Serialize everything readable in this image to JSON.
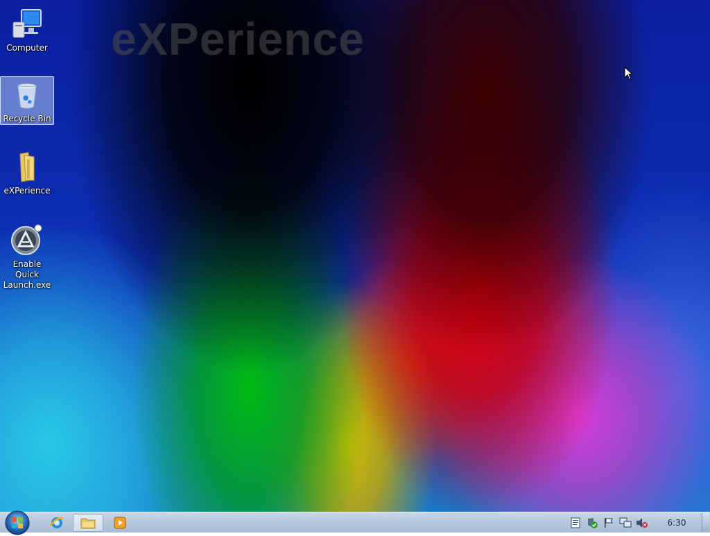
{
  "desktop": {
    "wallpaper_text": "eXPerience",
    "icons": [
      {
        "label": "Computer",
        "icon": "computer-icon"
      },
      {
        "label": "Recycle Bin",
        "icon": "recycle-bin-icon",
        "selected": true
      },
      {
        "label": "eXPerience",
        "icon": "folder-icon"
      },
      {
        "label": "Enable Quick\nLaunch.exe",
        "icon": "aero-app-icon"
      }
    ]
  },
  "taskbar": {
    "start_icon": "windows-orb-icon",
    "pinned": [
      {
        "icon": "internet-explorer-icon"
      },
      {
        "icon": "windows-explorer-icon",
        "active": true
      },
      {
        "icon": "media-player-icon"
      }
    ],
    "tray_icons": [
      "notes-icon",
      "security-shield-icon",
      "action-center-flag-icon",
      "network-icon",
      "volume-muted-icon"
    ],
    "clock": "6:30"
  },
  "colors": {
    "taskbar": "#b7c8dc",
    "selection": "#b4c8f0"
  }
}
